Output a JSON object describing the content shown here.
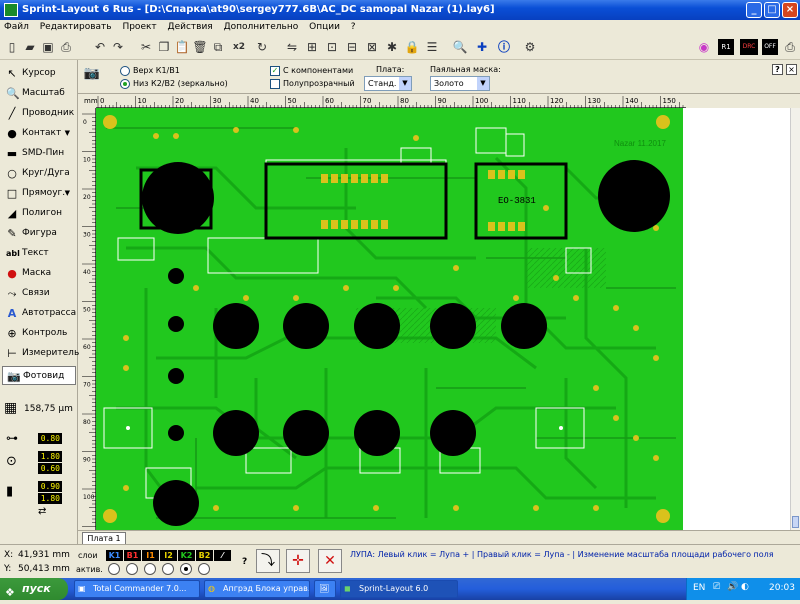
{
  "window": {
    "title": "Sprint-Layout 6 Rus - [D:\\Спарка\\at90\\sergey777.6B\\AC_DC samopal Nazar (1).lay6]"
  },
  "menu": [
    "Файл",
    "Редактировать",
    "Проект",
    "Действия",
    "Дополнительно",
    "Опции",
    "?"
  ],
  "toolbar": {
    "zoom_label": "x2",
    "ic_new": "new-icon",
    "ic_open": "open-icon",
    "ic_save": "save-icon",
    "ic_print": "print-icon",
    "ic_search": "magnifier-icon",
    "ic_info": "info-icon",
    "ic_gear": "gear-icon",
    "right_tags": [
      "R1",
      "DRC",
      "OFF"
    ]
  },
  "tools": [
    {
      "label": "Курсор",
      "icon": "cursor-icon"
    },
    {
      "label": "Масштаб",
      "icon": "zoom-icon"
    },
    {
      "label": "Проводник",
      "icon": "track-icon"
    },
    {
      "label": "Контакт",
      "icon": "pad-icon"
    },
    {
      "label": "SMD-Пин",
      "icon": "smd-icon"
    },
    {
      "label": "Круг/Дуга",
      "icon": "circle-icon"
    },
    {
      "label": "Прямоуг.",
      "icon": "rect-icon"
    },
    {
      "label": "Полигон",
      "icon": "polygon-icon"
    },
    {
      "label": "Фигура",
      "icon": "figure-icon"
    },
    {
      "label": "Текст",
      "icon": "text-icon"
    },
    {
      "label": "Маска",
      "icon": "mask-icon"
    },
    {
      "label": "Связи",
      "icon": "connections-icon"
    },
    {
      "label": "Автотрасса",
      "icon": "autoroute-icon"
    },
    {
      "label": "Контроль",
      "icon": "check-icon"
    },
    {
      "label": "Измеритель",
      "icon": "measure-icon"
    },
    {
      "label": "Фотовид",
      "icon": "photoview-icon"
    }
  ],
  "grid": {
    "value": "158,75 µm"
  },
  "params": {
    "track_width": "0.80",
    "pad_outer": "1.80",
    "pad_inner": "0.60",
    "smd_w": "0.90",
    "smd_h": "1.80"
  },
  "options": {
    "radio_top": "Верх К1/В1",
    "radio_bottom": "Низ К2/В2 (зеркально)",
    "chk_components": "С компонентами",
    "chk_translucent": "Полупрозрачный",
    "board_label": "Плата:",
    "board_value": "Станд.",
    "mask_label": "Паяльная маска:",
    "mask_value": "Золото"
  },
  "ruler": {
    "unit": "mm",
    "top_ticks": [
      "0",
      "10",
      "20",
      "30",
      "40",
      "50",
      "60",
      "70",
      "80",
      "90",
      "100",
      "110",
      "120",
      "130",
      "140",
      "150"
    ],
    "left_ticks": [
      "0",
      "10",
      "20",
      "30",
      "40",
      "50",
      "60",
      "70",
      "80",
      "90",
      "100",
      "110"
    ]
  },
  "board": {
    "watermark": "Nazar 11.2017",
    "chip_label": "ЕО-З831"
  },
  "tab": {
    "label": "Плата 1"
  },
  "status": {
    "x_label": "X:",
    "x_value": "41,931 mm",
    "y_label": "Y:",
    "y_value": "50,413 mm",
    "layers_label": "слои",
    "active_label": "актив.",
    "layers": [
      {
        "name": "K1",
        "color": "#3c8cff"
      },
      {
        "name": "B1",
        "color": "#ff3030"
      },
      {
        "name": "I1",
        "color": "#ff8c00"
      },
      {
        "name": "I2",
        "color": "#e6d200"
      },
      {
        "name": "K2",
        "color": "#22c81e"
      },
      {
        "name": "B2",
        "color": "#e6d200"
      }
    ],
    "help": "ЛУПА: Левый клик = Лупа + | Правый клик = Лупа - | Изменение масштаба площади рабочего поля"
  },
  "taskbar": {
    "start": "пуск",
    "tasks": [
      "Total Commander 7.0...",
      "Апгрэд Блока управ...",
      "",
      "Sprint-Layout 6.0"
    ],
    "lang": "EN",
    "time": "20:03"
  },
  "colors": {
    "board": "#21c81e",
    "copper": "#14a014",
    "pad": "#d9c21c",
    "outline": "#000000"
  }
}
